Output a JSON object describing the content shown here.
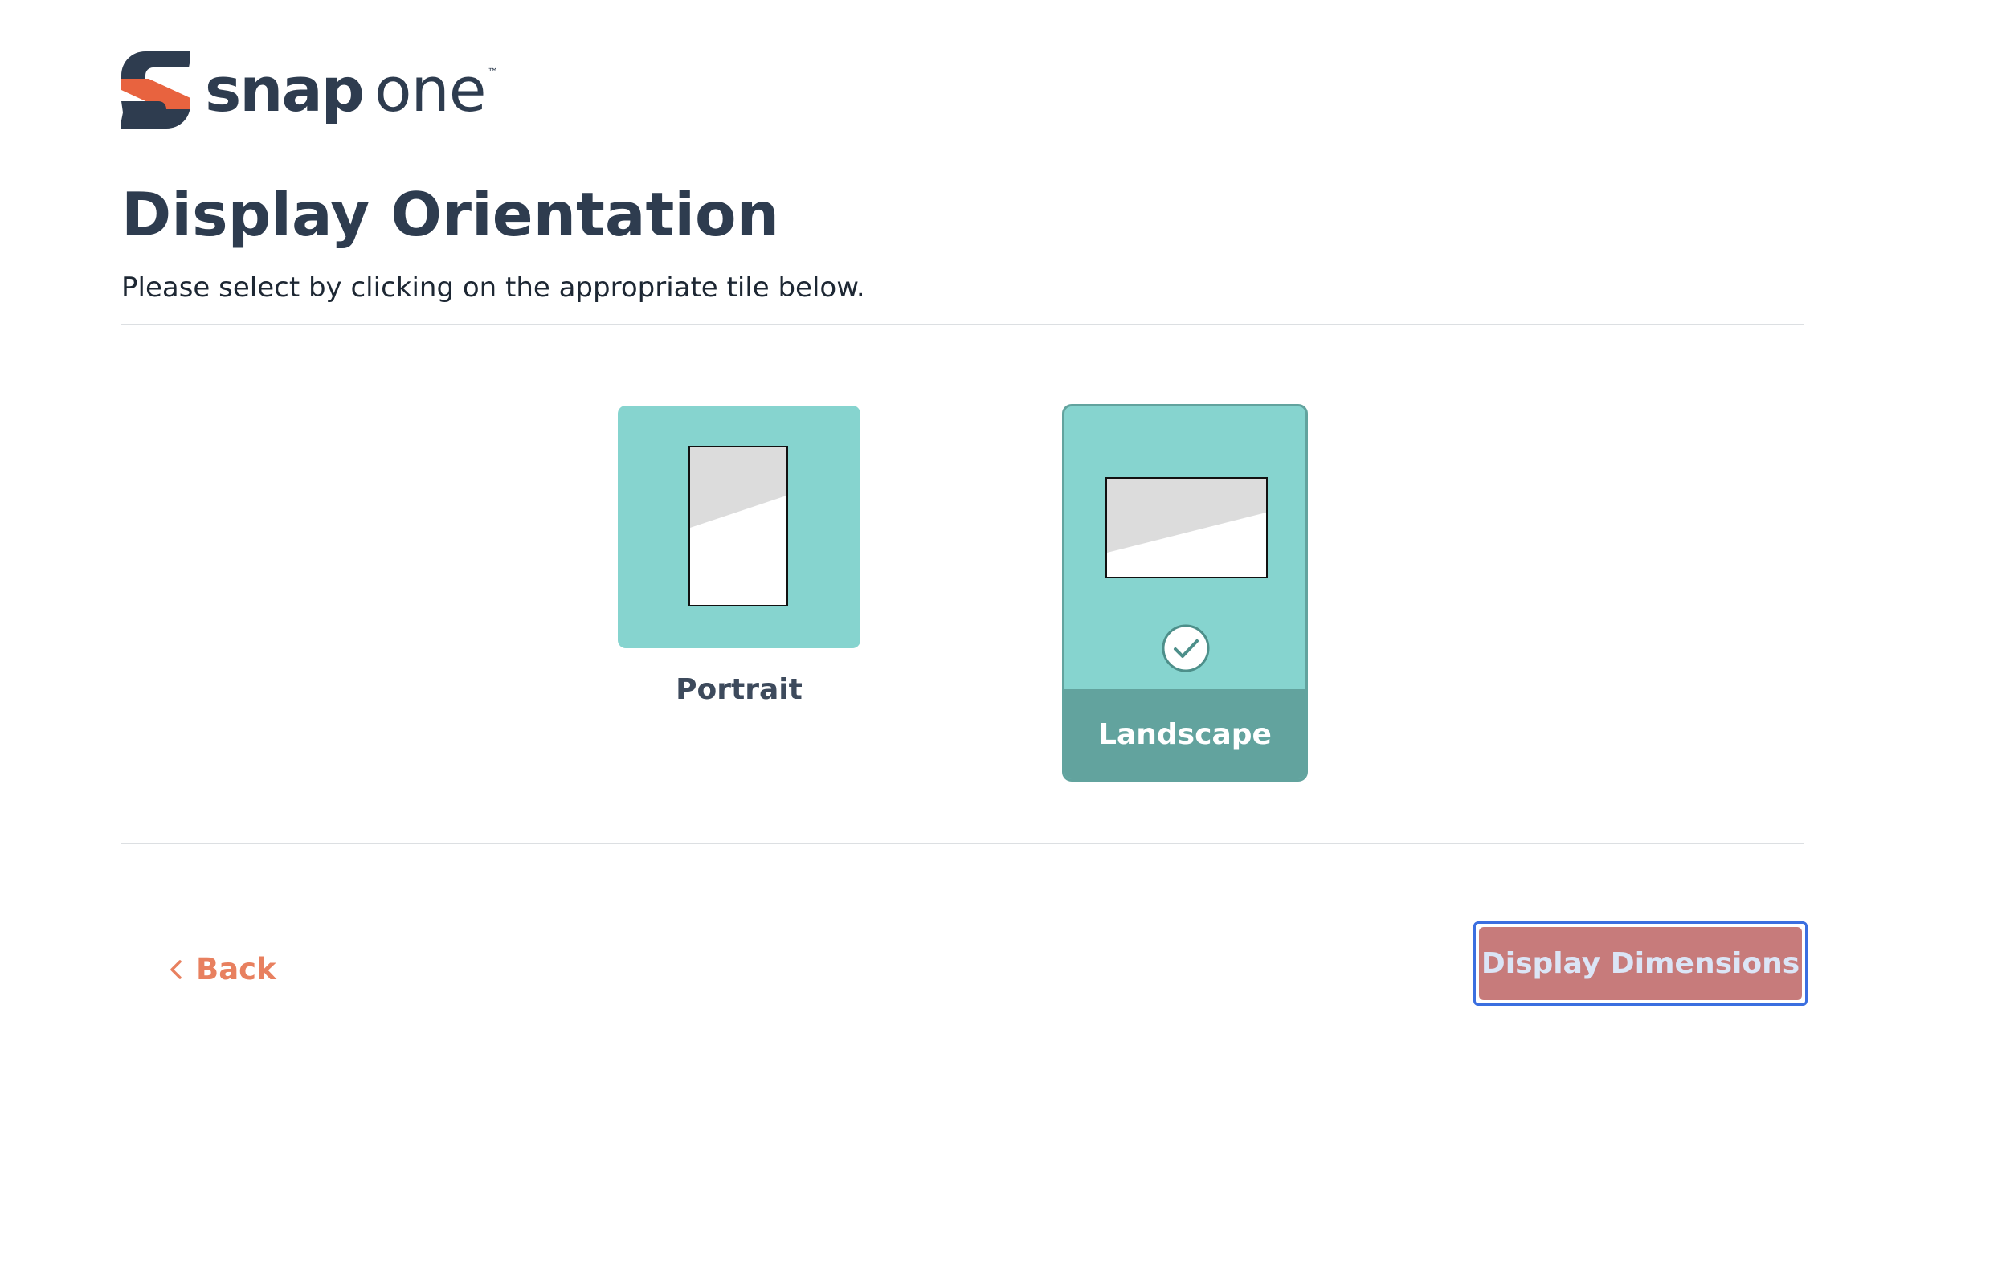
{
  "logo": {
    "word1": "snap",
    "word2": "one",
    "trademark": "TM",
    "colors": {
      "accent": "#e8633f",
      "dark": "#2e3c4f"
    }
  },
  "header": {
    "title": "Display Orientation",
    "subtitle": "Please select by clicking on the appropriate tile below."
  },
  "tiles": [
    {
      "id": "portrait",
      "label": "Portrait",
      "icon": "portrait-screen-icon",
      "selected": false
    },
    {
      "id": "landscape",
      "label": "Landscape",
      "icon": "landscape-screen-icon",
      "selected": true,
      "selected_icon": "check-circle-icon"
    }
  ],
  "nav": {
    "back_label": "Back",
    "back_icon": "chevron-left-icon",
    "next_label": "Display Dimensions"
  },
  "colors": {
    "tile_fill": "#86d4cf",
    "tile_selected_footer": "#62a39e",
    "title_text": "#2e3c4f",
    "back_link": "#e8805f",
    "next_button_fill": "#c77b7b",
    "next_button_text": "#dbe5f6",
    "focus_ring": "#3b6fe0"
  }
}
